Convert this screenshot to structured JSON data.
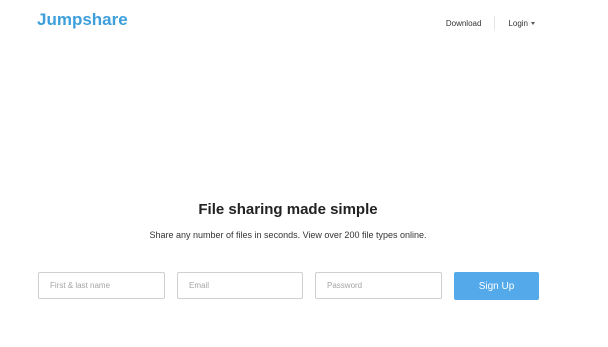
{
  "header": {
    "logo": "Jumpshare",
    "nav": {
      "download_label": "Download",
      "login_label": "Login"
    }
  },
  "hero": {
    "title": "File sharing made simple",
    "subtitle": "Share any number of files in seconds. View over 200 file types online."
  },
  "signup_form": {
    "name_placeholder": "First & last name",
    "email_placeholder": "Email",
    "password_placeholder": "Password",
    "submit_label": "Sign Up"
  },
  "colors": {
    "brand": "#3d9fdc",
    "button": "#54a9ea"
  }
}
